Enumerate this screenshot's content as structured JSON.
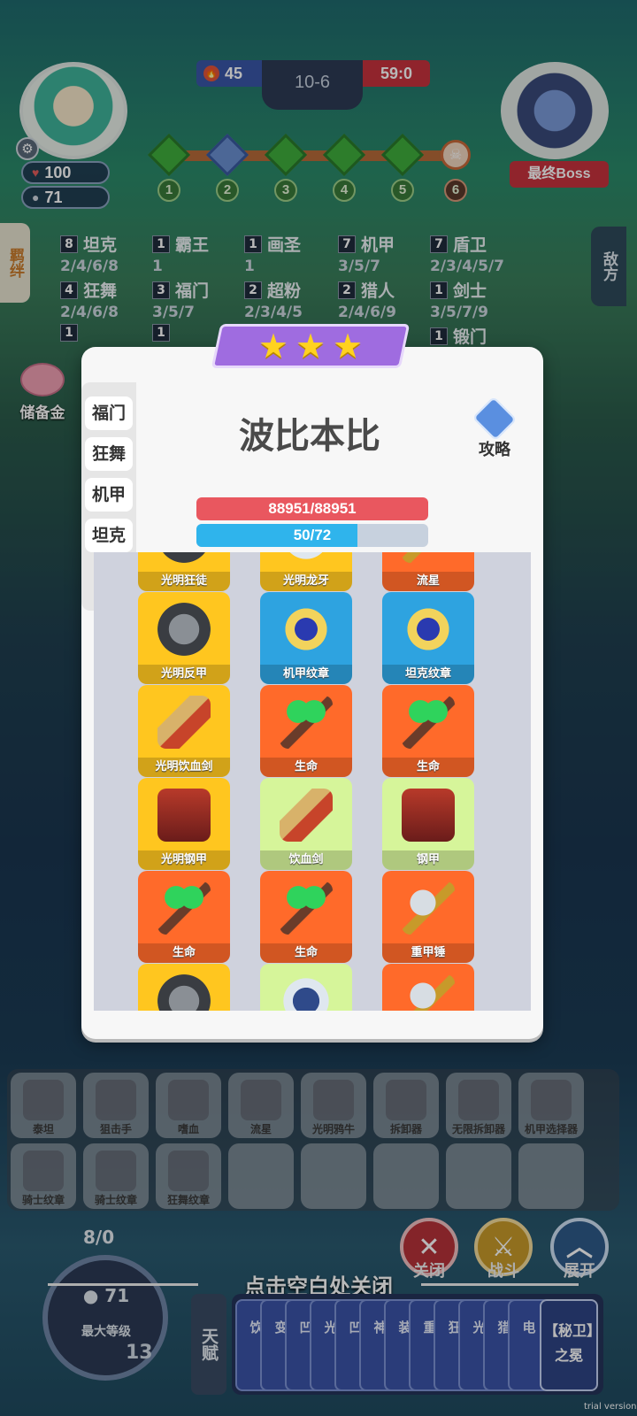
{
  "hud": {
    "hp": "100",
    "coins": "71",
    "turn_left": "45",
    "round": "10-6",
    "timer": "59:0",
    "stages": [
      "1",
      "2",
      "3",
      "4",
      "5",
      "6"
    ],
    "boss_label": "最终Boss"
  },
  "side": {
    "left_tab": "羁绊",
    "right_tab": "敌方",
    "piggy_label": "储备金"
  },
  "synergies": [
    {
      "count": "8",
      "name": "坦克",
      "levels": "2/4/6/8"
    },
    {
      "count": "1",
      "name": "霸王",
      "levels": "1"
    },
    {
      "count": "1",
      "name": "画圣",
      "levels": "1"
    },
    {
      "count": "7",
      "name": "机甲",
      "levels": "3/5/7"
    },
    {
      "count": "7",
      "name": "盾卫",
      "levels": "2/3/4/5/7"
    },
    {
      "count": "4",
      "name": "狂舞",
      "levels": "2/4/6/8"
    },
    {
      "count": "3",
      "name": "福门",
      "levels": "3/5/7"
    },
    {
      "count": "2",
      "name": "超粉",
      "levels": "2/3/4/5"
    },
    {
      "count": "2",
      "name": "猎人",
      "levels": "2/4/6/9"
    },
    {
      "count": "1",
      "name": "剑士",
      "levels": "3/5/7/9"
    },
    {
      "count": "1",
      "name": "",
      "levels": ""
    },
    {
      "count": "1",
      "name": "",
      "levels": ""
    },
    {
      "count": "1",
      "name": "锻门",
      "levels": ""
    }
  ],
  "modal": {
    "stars": 3,
    "hero_name": "波比本比",
    "strategy_label": "攻略",
    "tabs": [
      "福门",
      "狂舞",
      "机甲",
      "坦克"
    ],
    "hp_text": "88951/88951",
    "mp_text": "50/72",
    "mp_fraction": 0.694,
    "items": [
      {
        "label": "光明狂徒",
        "color": "y",
        "art": "armor"
      },
      {
        "label": "光明龙牙",
        "color": "y",
        "art": "misc"
      },
      {
        "label": "流星",
        "color": "o",
        "art": "hammer"
      },
      {
        "label": "光明反甲",
        "color": "y",
        "art": "armor"
      },
      {
        "label": "机甲纹章",
        "color": "b",
        "art": "badge"
      },
      {
        "label": "坦克纹章",
        "color": "b",
        "art": "badge"
      },
      {
        "label": "光明饮血剑",
        "color": "y",
        "art": "sword"
      },
      {
        "label": "生命",
        "color": "o",
        "art": "staff"
      },
      {
        "label": "生命",
        "color": "o",
        "art": "staff"
      },
      {
        "label": "光明钢甲",
        "color": "y",
        "art": "mail"
      },
      {
        "label": "饮血剑",
        "color": "g",
        "art": "sword"
      },
      {
        "label": "钢甲",
        "color": "g",
        "art": "mail"
      },
      {
        "label": "生命",
        "color": "o",
        "art": "staff"
      },
      {
        "label": "生命",
        "color": "o",
        "art": "staff"
      },
      {
        "label": "重甲锤",
        "color": "o",
        "art": "hammer"
      },
      {
        "label": "",
        "color": "y",
        "art": "armor"
      },
      {
        "label": "",
        "color": "g",
        "art": "misc"
      },
      {
        "label": "",
        "color": "o",
        "art": "hammer"
      }
    ]
  },
  "bench": {
    "row1": [
      "泰坦",
      "狙击手",
      "嗜血",
      "流星",
      "光明鸦牛",
      "拆卸器",
      "无限拆卸器",
      "机甲选择器"
    ],
    "row2": [
      "骑士纹章",
      "骑士纹章",
      "狂舞纹章",
      "",
      "",
      "",
      "",
      ""
    ]
  },
  "bottom": {
    "level_count": "8/0",
    "level_coins": "71",
    "level_label": "最大等级",
    "level_badge": "13",
    "close_hint": "点击空白处关闭",
    "close_btn": "关闭",
    "fight_btn": "战斗",
    "expand_btn": "展开",
    "talent_label": "天赋",
    "talent_cards": [
      "饮",
      "变",
      "凹",
      "光",
      "凹",
      "神",
      "装",
      "重",
      "狂",
      "光",
      "猎",
      "电"
    ],
    "talent_last": "【秘卫】之冕",
    "trial": "trial version"
  }
}
